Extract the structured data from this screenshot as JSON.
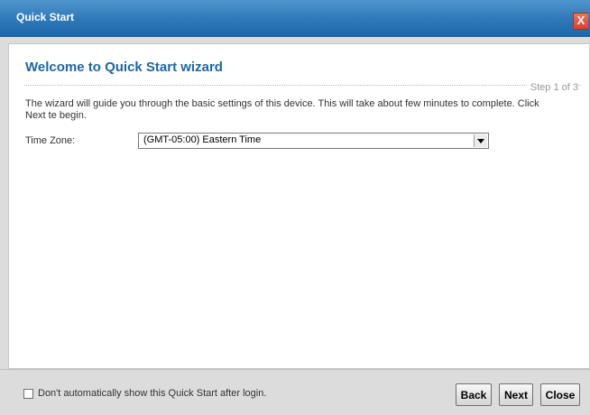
{
  "window": {
    "title": "Quick Start",
    "close_glyph": "X"
  },
  "wizard": {
    "heading": "Welcome to Quick Start wizard",
    "step": "Step 1 of 3",
    "description": "The wizard will guide you through the basic settings of this device. This will take about few minutes to complete. Click Next te begin."
  },
  "time_zone": {
    "label": "Time Zone:",
    "selected": "(GMT-05:00) Eastern Time"
  },
  "footer": {
    "checkbox_label": "Don't automatically show this Quick Start after login.",
    "checkbox_checked": false,
    "back_label": "Back",
    "next_label": "Next",
    "close_label": "Close"
  },
  "colors": {
    "title_bar": "#2e78b9",
    "heading": "#1f65a7",
    "close_button": "#d9432a"
  }
}
